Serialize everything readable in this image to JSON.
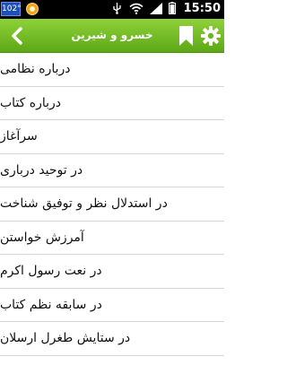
{
  "status_bar": {
    "badge": "102°",
    "time": "15:50",
    "icons": [
      "usb-icon",
      "wifi-icon",
      "signal-icon",
      "battery-icon"
    ]
  },
  "app_bar": {
    "title": "خسرو و شیرین",
    "back_icon": "chevron-left-icon",
    "bookmark_icon": "bookmark-icon",
    "settings_icon": "gear-icon",
    "color": "#6db621"
  },
  "list": {
    "items": [
      {
        "label": "درباره نظامی"
      },
      {
        "label": "درباره کتاب"
      },
      {
        "label": "سرآغاز"
      },
      {
        "label": "در توحید درباری"
      },
      {
        "label": "در استدلال نظر و توفیق شناخت"
      },
      {
        "label": "آمرزش خواستن"
      },
      {
        "label": "در نعت رسول اکرم"
      },
      {
        "label": "در سابقه نظم کتاب"
      },
      {
        "label": "در ستایش طغرل ارسلان"
      }
    ]
  }
}
